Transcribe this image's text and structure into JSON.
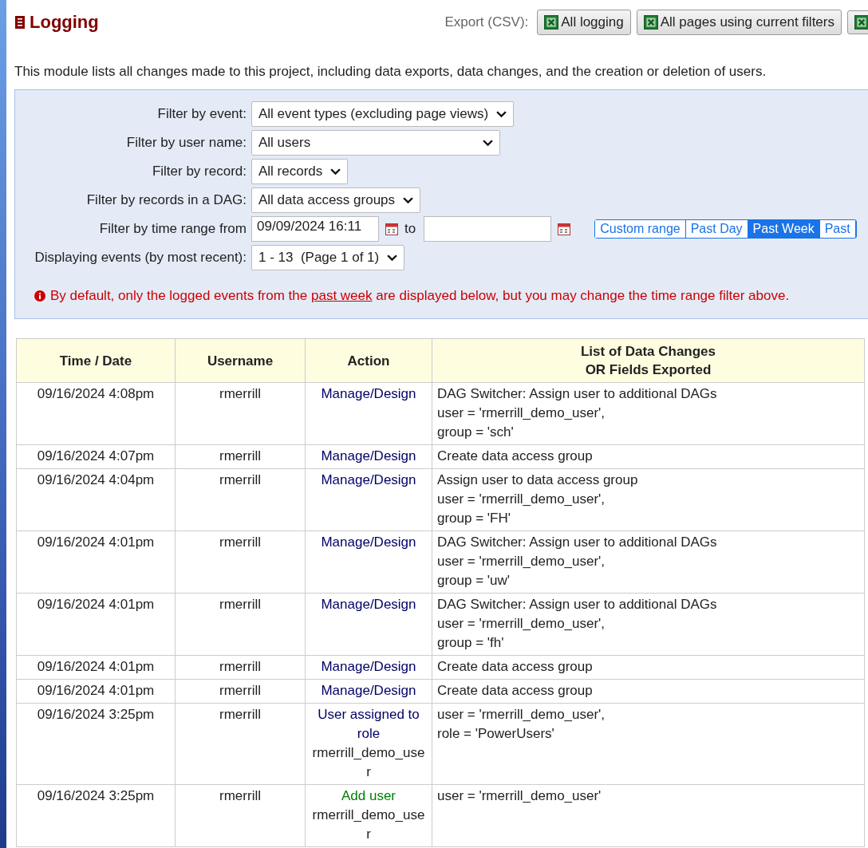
{
  "title": "Logging",
  "export": {
    "label": "Export (CSV):",
    "buttons": [
      {
        "kind": "text",
        "label": "All logging"
      },
      {
        "kind": "text",
        "label": "All pages using current filters"
      },
      {
        "kind": "icon"
      }
    ]
  },
  "description": "This module lists all changes made to this project, including data exports, data changes, and the creation or deletion of users.",
  "filters": [
    {
      "kind": "select",
      "label": "Filter by event:",
      "value": "All event types (excluding page views)"
    },
    {
      "kind": "select",
      "label": "Filter by user name:",
      "value": "All users"
    },
    {
      "kind": "select",
      "label": "Filter by record:",
      "value": "All records"
    },
    {
      "kind": "select",
      "label": "Filter by records in a DAG:",
      "value": "All data access groups"
    },
    {
      "kind": "date-range",
      "label": "Filter by time range from",
      "from": "09/09/2024 16:11",
      "to_label": "to",
      "ranges": [
        {
          "label": "Custom range",
          "selected": false
        },
        {
          "label": "Past Day",
          "selected": false
        },
        {
          "label": "Past Week",
          "selected": true
        },
        {
          "label": "Past",
          "selected": false
        }
      ]
    },
    {
      "kind": "select",
      "label": "Displaying events (by most recent):",
      "value": "1 - 13  (Page 1 of 1)"
    }
  ],
  "notice": {
    "before": "By default, only the logged events from the ",
    "link": "past week",
    "after": " are displayed below, but you may change the time range filter above."
  },
  "table": {
    "columns": [
      "Time / Date",
      "Username",
      "Action",
      "List of Data Changes\nOR Fields Exported"
    ],
    "rows": [
      {
        "time": "09/16/2024 4:08pm",
        "user": "rmerrill",
        "action": {
          "kind": "design",
          "text": "Manage/Design"
        },
        "changes": [
          "DAG Switcher: Assign user to additional DAGs",
          "user = 'rmerrill_demo_user',",
          "group = 'sch'"
        ]
      },
      {
        "time": "09/16/2024 4:07pm",
        "user": "rmerrill",
        "action": {
          "kind": "design",
          "text": "Manage/Design"
        },
        "changes": [
          "Create data access group"
        ]
      },
      {
        "time": "09/16/2024 4:04pm",
        "user": "rmerrill",
        "action": {
          "kind": "design",
          "text": "Manage/Design"
        },
        "changes": [
          "Assign user to data access group",
          "user = 'rmerrill_demo_user',",
          "group = 'FH'"
        ]
      },
      {
        "time": "09/16/2024 4:01pm",
        "user": "rmerrill",
        "action": {
          "kind": "design",
          "text": "Manage/Design"
        },
        "changes": [
          "DAG Switcher: Assign user to additional DAGs",
          "user = 'rmerrill_demo_user',",
          "group = 'uw'"
        ]
      },
      {
        "time": "09/16/2024 4:01pm",
        "user": "rmerrill",
        "action": {
          "kind": "design",
          "text": "Manage/Design"
        },
        "changes": [
          "DAG Switcher: Assign user to additional DAGs",
          "user = 'rmerrill_demo_user',",
          "group = 'fh'"
        ]
      },
      {
        "time": "09/16/2024 4:01pm",
        "user": "rmerrill",
        "action": {
          "kind": "design",
          "text": "Manage/Design"
        },
        "changes": [
          "Create data access group"
        ]
      },
      {
        "time": "09/16/2024 4:01pm",
        "user": "rmerrill",
        "action": {
          "kind": "design",
          "text": "Manage/Design"
        },
        "changes": [
          "Create data access group"
        ]
      },
      {
        "time": "09/16/2024 3:25pm",
        "user": "rmerrill",
        "action": {
          "kind": "user-role",
          "text": "User assigned to role",
          "detail": "rmerrill_demo_user"
        },
        "changes": [
          "user = 'rmerrill_demo_user',",
          "role = 'PowerUsers'"
        ]
      },
      {
        "time": "09/16/2024 3:25pm",
        "user": "rmerrill",
        "action": {
          "kind": "add-user",
          "text": "Add user",
          "detail": "rmerrill_demo_user"
        },
        "changes": [
          "user = 'rmerrill_demo_user'"
        ]
      }
    ]
  }
}
